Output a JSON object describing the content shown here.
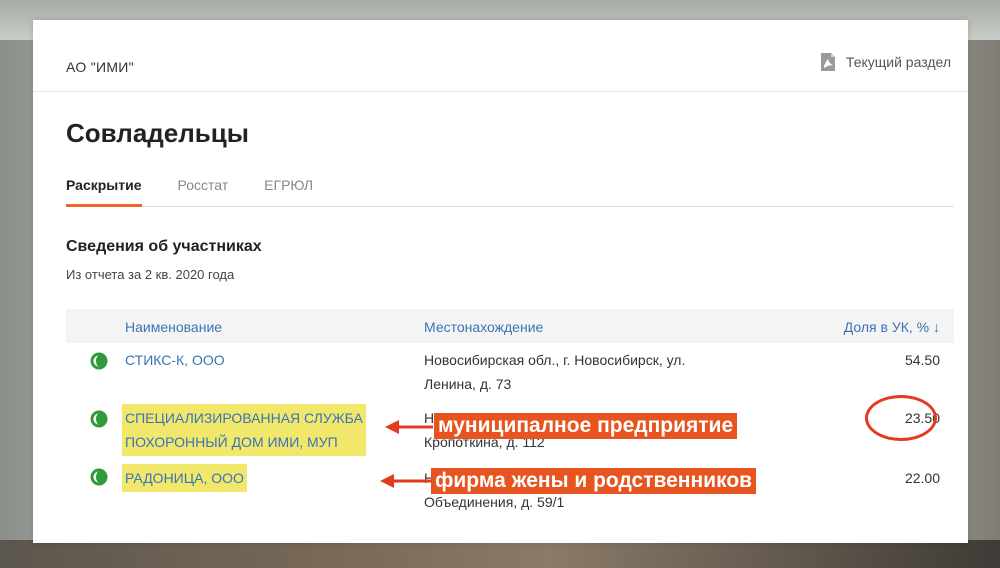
{
  "header": {
    "company": "АО \"ИМИ\"",
    "section_link": "Текущий раздел",
    "section_icon": "pdf-icon"
  },
  "page": {
    "title": "Совладельцы",
    "tabs": [
      {
        "label": "Раскрытие",
        "active": true
      },
      {
        "label": "Росстат",
        "active": false
      },
      {
        "label": "ЕГРЮЛ",
        "active": false
      }
    ],
    "subtitle": "Сведения об участниках",
    "report_note": "Из отчета за 2 кв. 2020 года"
  },
  "table": {
    "headers": {
      "name": "Наименование",
      "location": "Местонахождение",
      "share": "Доля в УК, % ↓"
    },
    "rows": [
      {
        "name_lines": [
          "СТИКС-К, ООО"
        ],
        "location_lines": [
          "Новосибирская обл., г. Новосибирск, ул.",
          "Ленина, д. 73"
        ],
        "share": "54.50",
        "status_icon": "active-status-icon",
        "highlighted": false
      },
      {
        "name_lines": [
          "СПЕЦИАЛИЗИРОВАННАЯ СЛУЖБА",
          "ПОХОРОННЫЙ ДОМ ИМИ, МУП"
        ],
        "location_lines": [
          "Н",
          "Кропоткина, д. 112"
        ],
        "share": "23.50",
        "status_icon": "active-status-icon",
        "highlighted": true
      },
      {
        "name_lines": [
          "РАДОНИЦА, ООО"
        ],
        "location_lines": [
          "Н",
          "Объединения, д. 59/1"
        ],
        "share": "22.00",
        "status_icon": "active-status-icon",
        "highlighted": true
      }
    ]
  },
  "annotations": {
    "municipal": "муниципалное предприятие",
    "family": "фирма жены и родственников"
  },
  "colors": {
    "accent_orange": "#e9662c",
    "link_blue": "#3a74b7",
    "highlight_yellow": "#f1e76b",
    "annotation_red": "#e7541f",
    "status_green": "#2e9a3a"
  }
}
